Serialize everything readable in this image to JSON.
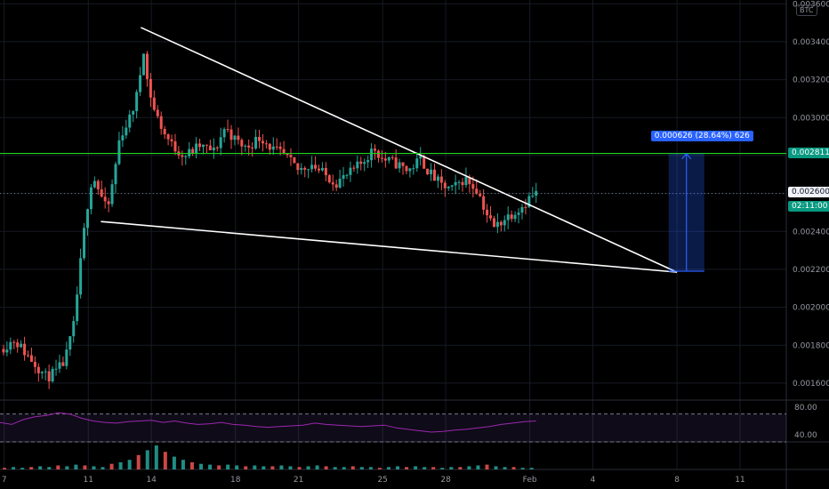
{
  "currency": "BTC",
  "colors": {
    "up": "#26a69a",
    "down": "#ef5350",
    "trendline": "#ffffff",
    "target_line": "#1ed51e",
    "measure": "#2962ff",
    "rsi": "#9c27b0"
  },
  "labels": {
    "current_price": "0.002600",
    "target_price": "0.002811",
    "countdown": "02:11:00",
    "measure": "0.000626 (28.64%) 626"
  },
  "chart_data": [
    {
      "type": "candlestick",
      "title": "",
      "ylim": [
        0.00152,
        0.00362
      ],
      "y_ticks": [
        "0.001600",
        "0.001800",
        "0.002000",
        "0.002200",
        "0.002400",
        "0.002600",
        "0.002800",
        "0.003000",
        "0.003200",
        "0.003400",
        "0.003600"
      ],
      "y_tick_values": [
        0.0016,
        0.0018,
        0.002,
        0.0022,
        0.0024,
        0.0026,
        0.0028,
        0.003,
        0.0032,
        0.0034,
        0.0036
      ],
      "x_ticks": [
        "7",
        "11",
        "14",
        "18",
        "21",
        "25",
        "28",
        "Feb",
        "4",
        "8",
        "11"
      ],
      "x_tick_days": [
        7,
        11,
        14,
        18,
        21,
        25,
        28,
        32,
        35,
        39,
        42
      ],
      "xlim_days": [
        6.8,
        44.2
      ],
      "close_path": [
        [
          6.8,
          0.00178
        ],
        [
          7.5,
          0.00183
        ],
        [
          8.0,
          0.00176
        ],
        [
          8.5,
          0.0017
        ],
        [
          9.0,
          0.00163
        ],
        [
          9.5,
          0.00166
        ],
        [
          9.9,
          0.00172
        ],
        [
          10.3,
          0.0019
        ],
        [
          10.6,
          0.0022
        ],
        [
          10.9,
          0.0025
        ],
        [
          11.2,
          0.0027
        ],
        [
          11.5,
          0.00262
        ],
        [
          11.9,
          0.0025
        ],
        [
          12.2,
          0.00268
        ],
        [
          12.5,
          0.0029
        ],
        [
          13.0,
          0.003
        ],
        [
          13.4,
          0.00315
        ],
        [
          13.6,
          0.0034
        ],
        [
          13.8,
          0.0032
        ],
        [
          14.1,
          0.00305
        ],
        [
          14.6,
          0.00292
        ],
        [
          15.0,
          0.00285
        ],
        [
          15.6,
          0.0028
        ],
        [
          16.3,
          0.00285
        ],
        [
          17.0,
          0.00282
        ],
        [
          17.5,
          0.00295
        ],
        [
          18.0,
          0.00288
        ],
        [
          18.5,
          0.00284
        ],
        [
          19.2,
          0.0029
        ],
        [
          19.8,
          0.00283
        ],
        [
          20.3,
          0.0028
        ],
        [
          21.0,
          0.00272
        ],
        [
          21.6,
          0.00276
        ],
        [
          22.2,
          0.0027
        ],
        [
          22.8,
          0.00266
        ],
        [
          23.4,
          0.0027
        ],
        [
          24.0,
          0.00276
        ],
        [
          24.6,
          0.00284
        ],
        [
          25.0,
          0.00278
        ],
        [
          25.6,
          0.00276
        ],
        [
          26.2,
          0.00272
        ],
        [
          26.8,
          0.00278
        ],
        [
          27.3,
          0.0027
        ],
        [
          27.8,
          0.00264
        ],
        [
          28.3,
          0.00262
        ],
        [
          28.9,
          0.00268
        ],
        [
          29.5,
          0.00262
        ],
        [
          30.0,
          0.00248
        ],
        [
          30.3,
          0.00242
        ],
        [
          30.7,
          0.00246
        ],
        [
          31.2,
          0.0025
        ],
        [
          31.7,
          0.00254
        ],
        [
          32.0,
          0.00258
        ],
        [
          32.3,
          0.0026
        ]
      ],
      "candles_per_day": 6
    },
    {
      "type": "line",
      "series": [
        {
          "name": "",
          "values": [
            58,
            55,
            62,
            66,
            68,
            72,
            70,
            64,
            60,
            58,
            57,
            59,
            60,
            61,
            58,
            60,
            57,
            55,
            56,
            58,
            55,
            54,
            52,
            51,
            52,
            53,
            54,
            57,
            55,
            54,
            53,
            52,
            53,
            54,
            50,
            48,
            46,
            44,
            45,
            47,
            48,
            50,
            52,
            55,
            57,
            59,
            60
          ]
        }
      ],
      "ylim": [
        30,
        90
      ],
      "y_ticks": [
        "40.00",
        "80.00"
      ],
      "y_tick_values": [
        40,
        80
      ],
      "band": [
        30,
        70
      ]
    },
    {
      "type": "bar",
      "series": [
        {
          "name": "",
          "values": [
            2,
            3,
            2,
            3,
            4,
            3,
            5,
            4,
            6,
            5,
            4,
            3,
            7,
            9,
            12,
            18,
            24,
            30,
            22,
            16,
            12,
            9,
            7,
            6,
            5,
            6,
            5,
            4,
            5,
            4,
            4,
            5,
            4,
            3,
            4,
            5,
            4,
            3,
            3,
            4,
            3,
            3,
            2,
            3,
            4,
            3,
            4,
            3,
            3,
            2,
            3,
            3,
            4,
            5,
            6,
            4,
            3,
            3,
            2,
            2
          ]
        }
      ],
      "xlim_days": [
        6.8,
        32.3
      ]
    }
  ]
}
